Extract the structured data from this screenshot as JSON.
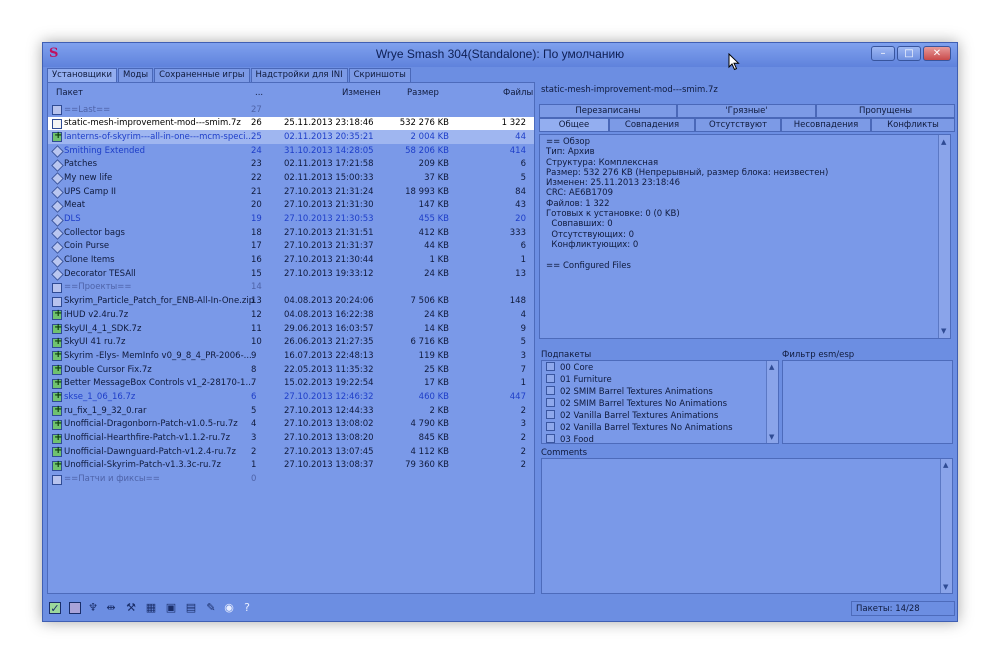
{
  "window": {
    "title": "Wrye Smash 304(Standalone): По умолчанию",
    "minimize": "–",
    "maximize": "□",
    "close": "✕"
  },
  "tabs": [
    {
      "label": "Установщики",
      "active": true
    },
    {
      "label": "Моды",
      "active": false
    },
    {
      "label": "Сохраненные игры",
      "active": false
    },
    {
      "label": "Надстройки для INI",
      "active": false
    },
    {
      "label": "Скриншоты",
      "active": false
    }
  ],
  "list": {
    "columns": {
      "name": "Пакет",
      "order": "...",
      "date": "Изменен",
      "size": "Размер",
      "files": "Файлы"
    },
    "rows": [
      {
        "icon": "sq",
        "style": "gray",
        "name": "==Last==",
        "n": "27",
        "date": "",
        "size": "",
        "files": ""
      },
      {
        "icon": "file",
        "style": "sel",
        "name": "static-mesh-improvement-mod---smim.7z",
        "n": "26",
        "date": "25.11.2013 23:18:46",
        "size": "532 276 KB",
        "files": "1 322"
      },
      {
        "icon": "plus",
        "style": "blue sel2",
        "name": "lanterns-of-skyrim---all-in-one---mcm-speci...",
        "n": "25",
        "date": "02.11.2013 20:35:21",
        "size": "2 004 KB",
        "files": "44"
      },
      {
        "icon": "diamond",
        "style": "blue",
        "name": "Smithing Extended",
        "n": "24",
        "date": "31.10.2013 14:28:05",
        "size": "58 206 KB",
        "files": "414"
      },
      {
        "icon": "diamond",
        "style": "",
        "name": "Patches",
        "n": "23",
        "date": "02.11.2013 17:21:58",
        "size": "209 KB",
        "files": "6"
      },
      {
        "icon": "diamond",
        "style": "",
        "name": "My new life",
        "n": "22",
        "date": "02.11.2013 15:00:33",
        "size": "37 KB",
        "files": "5"
      },
      {
        "icon": "diamond",
        "style": "",
        "name": "UPS Camp II",
        "n": "21",
        "date": "27.10.2013 21:31:24",
        "size": "18 993 KB",
        "files": "84"
      },
      {
        "icon": "diamond",
        "style": "",
        "name": "Meat",
        "n": "20",
        "date": "27.10.2013 21:31:30",
        "size": "147 KB",
        "files": "43"
      },
      {
        "icon": "diamond",
        "style": "blue",
        "name": "DLS",
        "n": "19",
        "date": "27.10.2013 21:30:53",
        "size": "455 KB",
        "files": "20"
      },
      {
        "icon": "diamond",
        "style": "",
        "name": "Collector bags",
        "n": "18",
        "date": "27.10.2013 21:31:51",
        "size": "412 KB",
        "files": "333"
      },
      {
        "icon": "diamond",
        "style": "",
        "name": "Coin Purse",
        "n": "17",
        "date": "27.10.2013 21:31:37",
        "size": "44 KB",
        "files": "6"
      },
      {
        "icon": "diamond",
        "style": "",
        "name": "Clone Items",
        "n": "16",
        "date": "27.10.2013 21:30:44",
        "size": "1 KB",
        "files": "1"
      },
      {
        "icon": "diamond",
        "style": "",
        "name": "Decorator TESAll",
        "n": "15",
        "date": "27.10.2013 19:33:12",
        "size": "24 KB",
        "files": "13"
      },
      {
        "icon": "sq",
        "style": "gray",
        "name": "==Проекты==",
        "n": "14",
        "date": "",
        "size": "",
        "files": ""
      },
      {
        "icon": "sq",
        "style": "",
        "name": "Skyrim_Particle_Patch_for_ENB-All-In-One.zip",
        "n": "13",
        "date": "04.08.2013 20:24:06",
        "size": "7 506 KB",
        "files": "148"
      },
      {
        "icon": "plus",
        "style": "",
        "name": "iHUD v2.4ru.7z",
        "n": "12",
        "date": "04.08.2013 16:22:38",
        "size": "24 KB",
        "files": "4"
      },
      {
        "icon": "plus",
        "style": "",
        "name": "SkyUI_4_1_SDK.7z",
        "n": "11",
        "date": "29.06.2013 16:03:57",
        "size": "14 KB",
        "files": "9"
      },
      {
        "icon": "plus",
        "style": "",
        "name": "SkyUI 41 ru.7z",
        "n": "10",
        "date": "26.06.2013 21:27:35",
        "size": "6 716 KB",
        "files": "5"
      },
      {
        "icon": "plus",
        "style": "",
        "name": "Skyrim -Elys- MemInfo v0_9_8_4_PR-2006-...",
        "n": "9",
        "date": "16.07.2013 22:48:13",
        "size": "119 KB",
        "files": "3"
      },
      {
        "icon": "plus",
        "style": "",
        "name": "Double Cursor Fix.7z",
        "n": "8",
        "date": "22.05.2013 11:35:32",
        "size": "25 KB",
        "files": "7"
      },
      {
        "icon": "plus",
        "style": "",
        "name": "Better MessageBox Controls v1_2-28170-1...",
        "n": "7",
        "date": "15.02.2013 19:22:54",
        "size": "17 KB",
        "files": "1"
      },
      {
        "icon": "plus",
        "style": "blue",
        "name": "skse_1_06_16.7z",
        "n": "6",
        "date": "27.10.2013 12:46:32",
        "size": "460 KB",
        "files": "447"
      },
      {
        "icon": "plus",
        "style": "",
        "name": "ru_fix_1_9_32_0.rar",
        "n": "5",
        "date": "27.10.2013 12:44:33",
        "size": "2 KB",
        "files": "2"
      },
      {
        "icon": "plus",
        "style": "",
        "name": "Unofficial-Dragonborn-Patch-v1.0.5-ru.7z",
        "n": "4",
        "date": "27.10.2013 13:08:02",
        "size": "4 790 KB",
        "files": "3"
      },
      {
        "icon": "plus",
        "style": "",
        "name": "Unofficial-Hearthfire-Patch-v1.1.2-ru.7z",
        "n": "3",
        "date": "27.10.2013 13:08:20",
        "size": "845 KB",
        "files": "2"
      },
      {
        "icon": "plus",
        "style": "",
        "name": "Unofficial-Dawnguard-Patch-v1.2.4-ru.7z",
        "n": "2",
        "date": "27.10.2013 13:07:45",
        "size": "4 112 KB",
        "files": "2"
      },
      {
        "icon": "plus",
        "style": "",
        "name": "Unofficial-Skyrim-Patch-v1.3.3c-ru.7z",
        "n": "1",
        "date": "27.10.2013 13:08:37",
        "size": "79 360 KB",
        "files": "2"
      },
      {
        "icon": "sq",
        "style": "gray",
        "name": "==Патчи и фиксы==",
        "n": "0",
        "date": "",
        "size": "",
        "files": ""
      }
    ]
  },
  "details": {
    "package_title": "static-mesh-improvement-mod---smim.7z",
    "tabs_top": [
      "Перезаписаны",
      "'Грязные'",
      "Пропущены"
    ],
    "tabs_bottom": [
      "Общее",
      "Совпадения",
      "Отсутствуют",
      "Несовпадения",
      "Конфликты"
    ],
    "info_lines": [
      "== Обзор",
      "Тип: Архив",
      "Структура: Комплексная",
      "Размер: 532 276 KB (Непрерывный, размер блока: неизвестен)",
      "Изменен: 25.11.2013 23:18:46",
      "CRC: AE6B1709",
      "Файлов: 1 322",
      "Готовых к установке: 0 (0 KB)",
      "  Совпавших: 0",
      "  Отсутствующих: 0",
      "  Конфликтующих: 0",
      "",
      "== Configured Files"
    ],
    "subpackages_label": "Подпакеты",
    "subpackages": [
      "00 Core",
      "01 Furniture",
      "02 SMIM Barrel Textures Animations",
      "02 SMIM Barrel Textures No Animations",
      "02 Vanilla Barrel Textures Animations",
      "02 Vanilla Barrel Textures No Animations",
      "03 Food"
    ],
    "filter_label": "Фильтр esm/esp",
    "comments_label": "Comments"
  },
  "statusbar": {
    "icons": [
      "check-icon",
      "square-icon",
      "pin-icon",
      "arrows-icon",
      "tools-icon",
      "wrench-icon",
      "image-icon",
      "screen-icon",
      "pen-icon",
      "circle-icon",
      "help-icon"
    ],
    "packages_count": "Пакеты: 14/28"
  },
  "colors": {
    "window_bg": "#6c8ee2",
    "selected_row": "#ffffff",
    "active_text": "#1e3ec8"
  }
}
